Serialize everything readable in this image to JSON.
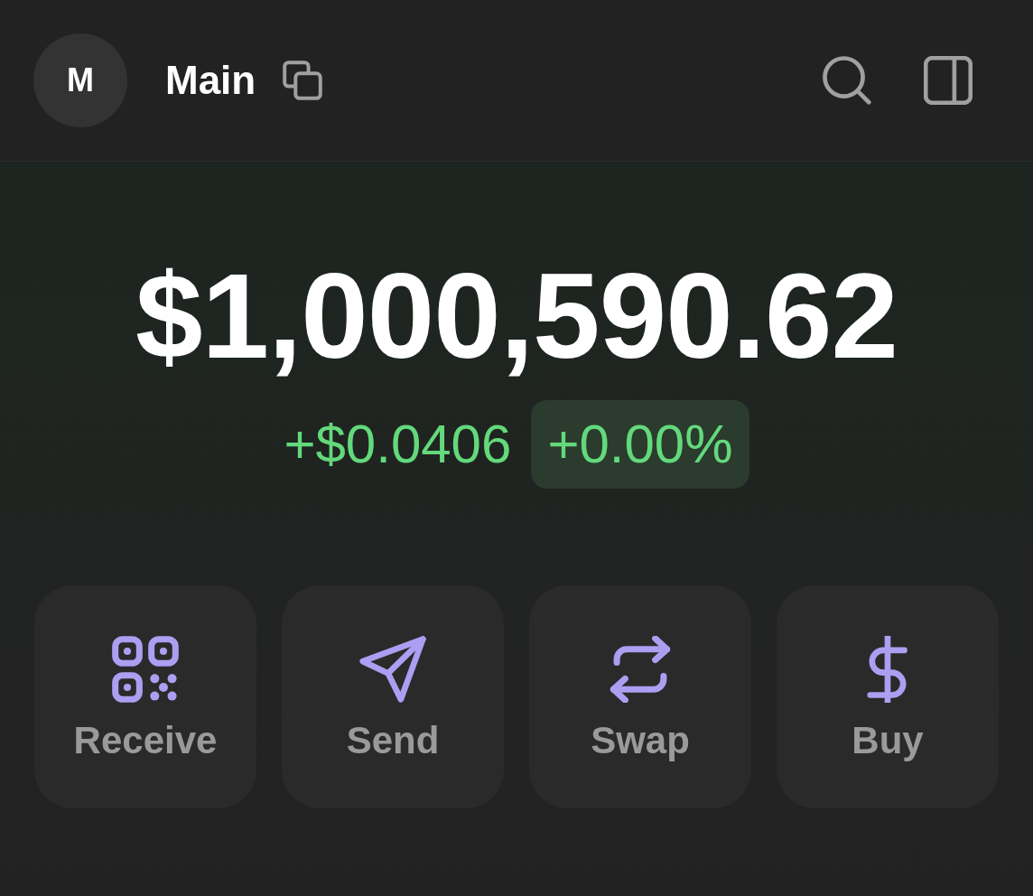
{
  "header": {
    "avatar_initial": "M",
    "account_name": "Main"
  },
  "balance": {
    "amount": "$1,000,590.62",
    "change": "+$0.0406",
    "change_percent": "+0.00%"
  },
  "actions": [
    {
      "kind": "receive",
      "label": "Receive"
    },
    {
      "kind": "send",
      "label": "Send"
    },
    {
      "kind": "swap",
      "label": "Swap"
    },
    {
      "kind": "buy",
      "label": "Buy"
    }
  ]
}
